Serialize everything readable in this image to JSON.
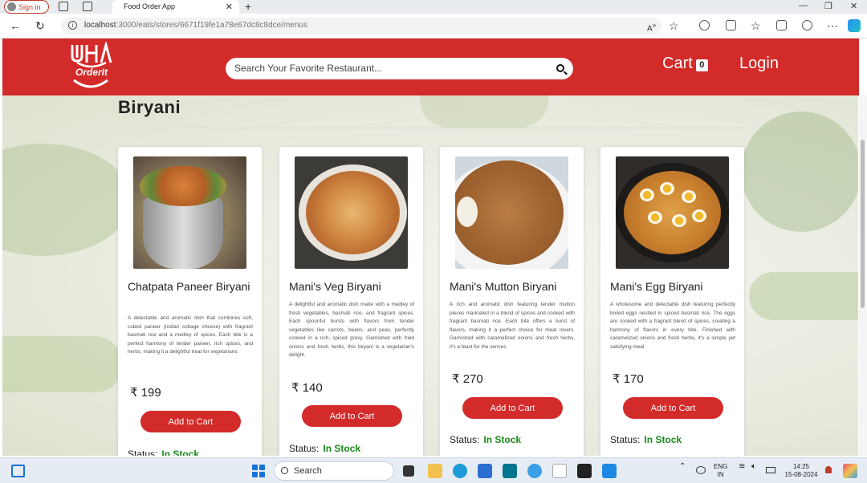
{
  "browser": {
    "signin_label": "Sign in",
    "tab_title": "Food Order App",
    "url_host": "localhost",
    "url_path": ":3000/eats/stores/6671f19fe1a78e67dc8c8dce/menus"
  },
  "header": {
    "logo_text": "OrderIt",
    "search_placeholder": "Search Your Favorite Restaurant...",
    "cart_label": "Cart",
    "cart_count": "0",
    "login_label": "Login"
  },
  "menu": {
    "section_title": "Biryani",
    "items": [
      {
        "name": "Chatpata Paneer Biryani",
        "description": "A delectable and aromatic dish that combines soft, cubed paneer (Indian cottage cheese) with fragrant basmati rice and a medley of spices. Each bite is a perfect harmony of tender paneer, rich spices, and herbs, making it a delightful treat for vegetarians.",
        "currency": "₹",
        "price": "199",
        "button_label": "Add to Cart",
        "status_label": "Status:",
        "stock_label": "In Stock"
      },
      {
        "name": "Mani's Veg Biryani",
        "description": "A delightful and aromatic dish made with a medley of fresh vegetables, basmati rice, and fragrant spices. Each spoonful bursts with flavors from tender vegetables like carrots, beans, and peas, perfectly cooked in a rich, spiced gravy. Garnished with fried onions and fresh herbs, this biryani is a vegetarian's delight.",
        "currency": "₹",
        "price": "140",
        "button_label": "Add to Cart",
        "status_label": "Status:",
        "stock_label": "In Stock"
      },
      {
        "name": "Mani's Mutton Biryani",
        "description": "A rich and aromatic dish featuring tender mutton pieces marinated in a blend of spices and cooked with fragrant basmati rice. Each bite offers a burst of flavors, making it a perfect choice for meat lovers. Garnished with caramelized onions and fresh herbs, it's a feast for the senses",
        "currency": "₹",
        "price": "270",
        "button_label": "Add to Cart",
        "status_label": "Status:",
        "stock_label": "In Stock"
      },
      {
        "name": "Mani's Egg Biryani",
        "description": "A wholesome and delectable dish featuring perfectly boiled eggs nestled in spiced basmati rice. The eggs are cooked with a fragrant blend of spices, creating a harmony of flavors in every bite. Finished with caramelized onions and fresh herbs, it's a simple yet satisfying meal.",
        "currency": "₹",
        "price": "170",
        "button_label": "Add to Cart",
        "status_label": "Status:",
        "stock_label": "In Stock"
      }
    ]
  },
  "taskbar": {
    "search_label": "Search",
    "lang_line1": "ENG",
    "lang_line2": "IN",
    "time": "14:25",
    "date": "15-08-2024"
  },
  "colors": {
    "brand_red": "#d32a2a",
    "in_stock_green": "#1a8a1a"
  }
}
